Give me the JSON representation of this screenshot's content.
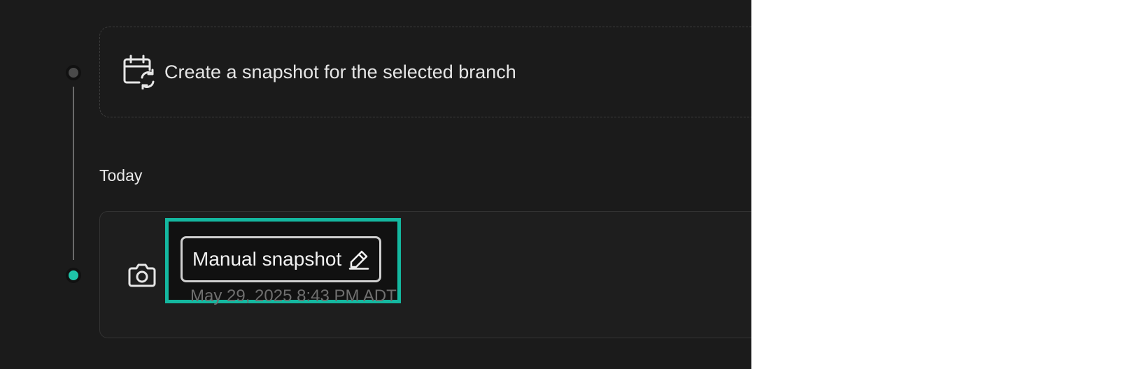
{
  "timeline": {
    "create_label": "Create a snapshot for the selected branch",
    "section_label": "Today"
  },
  "snapshot": {
    "name": "Manual snapshot",
    "date": "May 29, 2025 8:43 PM ADT"
  },
  "colors": {
    "accent": "#14b8a0",
    "background": "#1b1b1b",
    "text": "#e6e6e6",
    "muted": "#6f6f6f"
  },
  "icons": {
    "create": "calendar-refresh-icon",
    "snapshot": "camera-icon",
    "edit": "pencil-icon"
  }
}
